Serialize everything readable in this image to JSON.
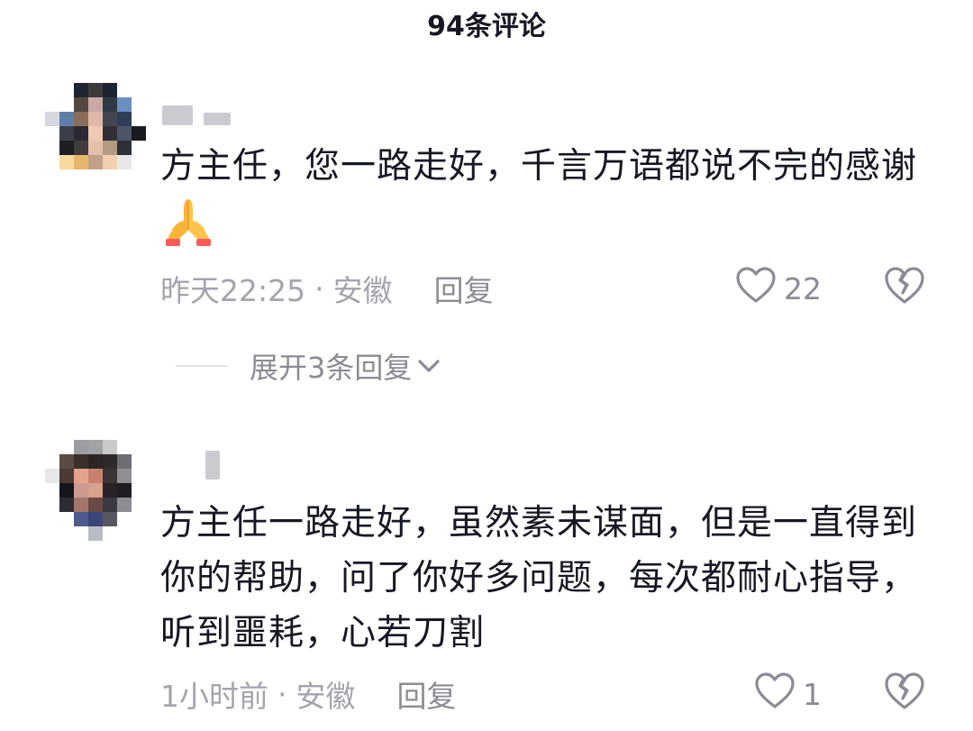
{
  "header": {
    "title": "94条评论"
  },
  "comments": [
    {
      "text": "方主任，您一路走好，千言万语都说不完的感谢",
      "emoji": "🙏",
      "time": "昨天22:25",
      "dot": "·",
      "location": "安徽",
      "reply_label": "回复",
      "likes": "22",
      "expand_label": "展开3条回复",
      "avatar_colors": [
        "#ffffff",
        "#ffffff",
        "#1f2530",
        "#3d3a3b",
        "#1c2431",
        "#ffffff",
        "#ffffff",
        "#ffffff",
        "#ffffff",
        "#54473f",
        "#c9a9a6",
        "#2f3a45",
        "#6b8ec0",
        "#ffffff",
        "#d5d8de",
        "#5e7ea8",
        "#8a6c5a",
        "#e0b7a8",
        "#434652",
        "#2f3e57",
        "#ffffff",
        "#ffffff",
        "#3b3e48",
        "#2b2a33",
        "#f0c9b3",
        "#312f35",
        "#4b5666",
        "#191b1f",
        "#ffffff",
        "#1d1f24",
        "#403b3c",
        "#e5c0a8",
        "#b29a83",
        "#2d3038",
        "#ffffff",
        "#ffffff",
        "#f7d99a",
        "#e6b76a",
        "#c2a18b",
        "#f2cfaf",
        "#e8e8ea",
        "#ffffff",
        "#ffffff",
        "#ffffff",
        "#ffffff",
        "#ffffff",
        "#ffffff",
        "#ffffff",
        "#ffffff"
      ]
    },
    {
      "text": "方主任一路走好，虽然素未谋面，但是一直得到你的帮助，问了你好多问题，每次都耐心指导，听到噩耗，心若刀割",
      "time": "1小时前",
      "dot": "·",
      "location": "安徽",
      "reply_label": "回复",
      "likes": "1",
      "avatar_colors": [
        "#ffffff",
        "#ffffff",
        "#9c9da2",
        "#a3a3a6",
        "#c9cacb",
        "#ffffff",
        "#ffffff",
        "#ffffff",
        "#5b4b42",
        "#3a2f2b",
        "#2b2525",
        "#2e2a2b",
        "#6d6e72",
        "#ffffff",
        "#e6e7ea",
        "#4c3a34",
        "#e4a38c",
        "#c9816f",
        "#3a3434",
        "#8f8f93",
        "#ffffff",
        "#ffffff",
        "#14161c",
        "#cd9a8f",
        "#d7a190",
        "#262226",
        "#1e1d22",
        "#ffffff",
        "#ffffff",
        "#2d2c34",
        "#a2766d",
        "#6a4a45",
        "#3b3a44",
        "#8d8c92",
        "#ffffff",
        "#ffffff",
        "#ffffff",
        "#4d5c8c",
        "#3a4677",
        "#585862",
        "#ffffff",
        "#ffffff",
        "#ffffff",
        "#ffffff",
        "#ffffff",
        "#b9bcc6",
        "#ffffff",
        "#ffffff",
        "#ffffff"
      ]
    }
  ],
  "icons": {
    "heart": "heart-outline-icon",
    "dislike": "broken-heart-icon",
    "expand": "chevron-down-icon"
  }
}
